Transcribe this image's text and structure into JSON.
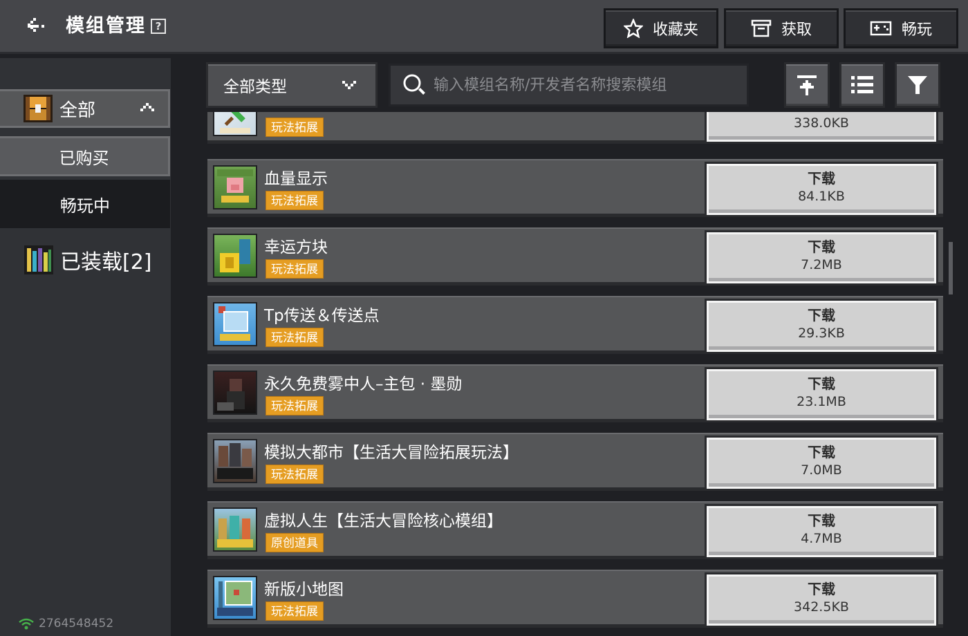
{
  "header": {
    "title": "模组管理",
    "help": "?",
    "buttons": [
      {
        "label": "收藏夹",
        "icon": "star-icon"
      },
      {
        "label": "获取",
        "icon": "archive-icon"
      },
      {
        "label": "畅玩",
        "icon": "gamepad-icon"
      }
    ]
  },
  "sidebar": {
    "all": "全部",
    "purchased": "已购买",
    "playing": "畅玩中",
    "installed": "已装载[2]",
    "status": "2764548452"
  },
  "toolbar": {
    "type_select": "全部类型",
    "search_placeholder": "输入模组名称/开发者名称搜索模组"
  },
  "list": {
    "download_label": "下载",
    "items": [
      {
        "title": "",
        "tag": "玩法拓展",
        "size": "338.0KB"
      },
      {
        "title": "血量显示",
        "tag": "玩法拓展",
        "size": "84.1KB"
      },
      {
        "title": "幸运方块",
        "tag": "玩法拓展",
        "size": "7.2MB"
      },
      {
        "title": "Tp传送＆传送点",
        "tag": "玩法拓展",
        "size": "29.3KB"
      },
      {
        "title": "永久免费雾中人–主包 · 墨勋",
        "tag": "玩法拓展",
        "size": "23.1MB"
      },
      {
        "title": "模拟大都市【生活大冒险拓展玩法】",
        "tag": "玩法拓展",
        "size": "7.0MB"
      },
      {
        "title": "虚拟人生【生活大冒险核心模组】",
        "tag": "原创道具",
        "size": "4.7MB"
      },
      {
        "title": "新版小地图",
        "tag": "玩法拓展",
        "size": "342.5KB"
      }
    ]
  },
  "colors": {
    "header_bg": "#45464a",
    "sidebar_bg": "#303236",
    "row_bg": "#555658",
    "tag_bg": "#e59d22",
    "download_bg": "#d1d1d1"
  }
}
